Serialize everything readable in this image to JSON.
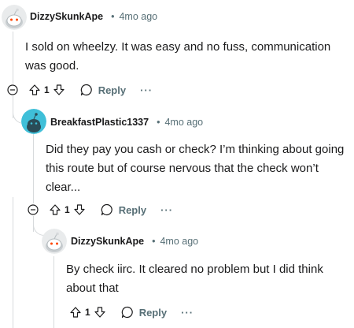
{
  "comments": [
    {
      "author": "DizzySkunkApe",
      "separator": "•",
      "time": "4mo ago",
      "body": "I sold on wheelzy. It was easy and no fuss, communication was good.",
      "votes": "1",
      "reply_label": "Reply",
      "more_label": "···"
    },
    {
      "author": "BreakfastPlastic1337",
      "separator": "•",
      "time": "4mo ago",
      "body": "Did they pay you cash or check? I’m thinking about going this route but of course nervous that the check won’t clear...",
      "votes": "1",
      "reply_label": "Reply",
      "more_label": "···"
    },
    {
      "author": "DizzySkunkApe",
      "separator": "•",
      "time": "4mo ago",
      "body": "By check iirc. It cleared no problem but I did think about that",
      "votes": "1",
      "reply_label": "Reply",
      "more_label": "···"
    }
  ],
  "icons": {
    "avatar_snoo_gray": "snoo-avatar-icon",
    "avatar_snoo_teal": "snoo-avatar-icon",
    "collapse": "collapse-thread-icon",
    "upvote": "upvote-icon",
    "downvote": "downvote-icon",
    "reply": "comment-bubble-icon"
  },
  "colors": {
    "text": "#1a1a1b",
    "meta": "#576f76",
    "thread_line": "#d7dadc",
    "teal_avatar": "#3fbfd8"
  }
}
